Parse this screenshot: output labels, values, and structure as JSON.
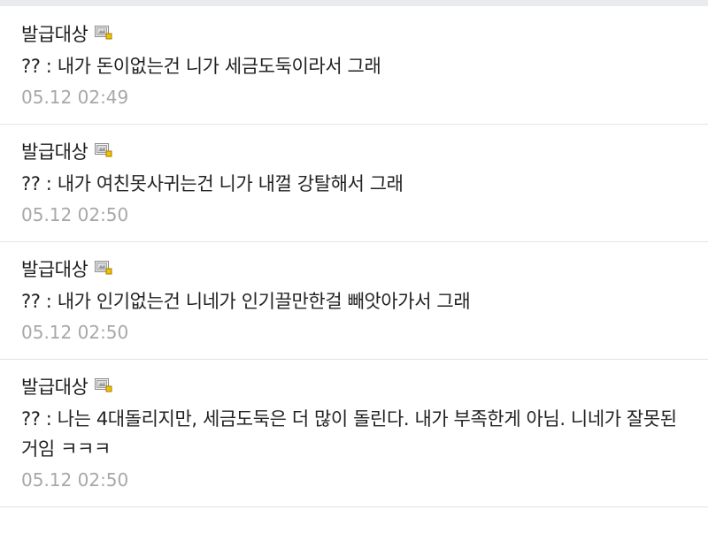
{
  "comments": [
    {
      "author": "발급대상",
      "author_icon": "member-badge-icon",
      "text": "?? : 내가 돈이없는건 니가 세금도둑이라서 그래",
      "time": "05.12 02:49"
    },
    {
      "author": "발급대상",
      "author_icon": "member-badge-icon",
      "text": "?? : 내가 여친못사귀는건 니가 내껄 강탈해서 그래",
      "time": "05.12 02:50"
    },
    {
      "author": "발급대상",
      "author_icon": "member-badge-icon",
      "text": "?? : 내가 인기없는건 니네가 인기끌만한걸 빼앗아가서 그래",
      "time": "05.12 02:50"
    },
    {
      "author": "발급대상",
      "author_icon": "member-badge-icon",
      "text": "?? : 나는 4대돌리지만, 세금도둑은 더 많이 돌린다. 내가 부족한게 아님. 니네가 잘못된거임 ㅋㅋㅋ",
      "time": "05.12 02:50"
    }
  ],
  "colors": {
    "text": "#222222",
    "timestamp": "#a8a8a8",
    "divider": "#e2e4e8",
    "top_strip": "#e9ebef",
    "badge_accent": "#f2c200"
  }
}
